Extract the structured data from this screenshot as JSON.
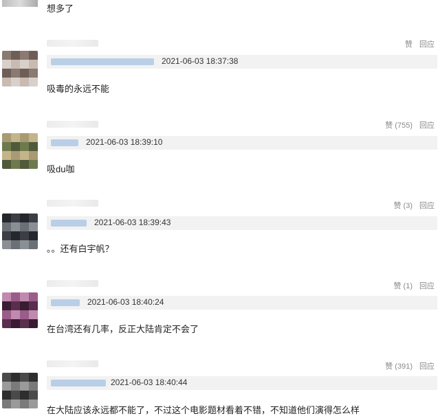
{
  "header_comment": {
    "text": "想多了"
  },
  "comments": [
    {
      "actions": {
        "like": "赞",
        "reply": "回应"
      },
      "timestamp": "2021-06-03 18:37:38",
      "text": "吸毒的永远不能",
      "avatar_colors": [
        "#8a7a72",
        "#c9bbb2",
        "#6f5e57",
        "#d8d0ca"
      ]
    },
    {
      "actions": {
        "like": "赞 (755)",
        "reply": "回应"
      },
      "timestamp": "2021-06-03 18:39:10",
      "text": "吸du咖",
      "avatar_colors": [
        "#6e7a4e",
        "#a89a72",
        "#4f5a3a",
        "#c4b48a"
      ]
    },
    {
      "actions": {
        "like": "赞 (3)",
        "reply": "回应"
      },
      "timestamp": "2021-06-03 18:39:43",
      "text": "。。还有白宇帆？",
      "avatar_colors": [
        "#3b3e44",
        "#6b6f76",
        "#24272c",
        "#8a8f96"
      ]
    },
    {
      "actions": {
        "like": "赞 (1)",
        "reply": "回应"
      },
      "timestamp": "2021-06-03 18:40:24",
      "text": "在台湾还有几率，反正大陆肯定不会了",
      "avatar_colors": [
        "#5a2f4e",
        "#9a5c88",
        "#3a1c32",
        "#c08ab0"
      ]
    },
    {
      "actions": {
        "like": "赞 (391)",
        "reply": "回应"
      },
      "timestamp": "2021-06-03 18:40:44",
      "text": "在大陆应该永远都不能了，不过这个电影题材看着不错，不知道他们演得怎么样",
      "avatar_colors": [
        "#4a4a4a",
        "#7a7a7a",
        "#2e2e2e",
        "#9a9a9a"
      ]
    }
  ]
}
